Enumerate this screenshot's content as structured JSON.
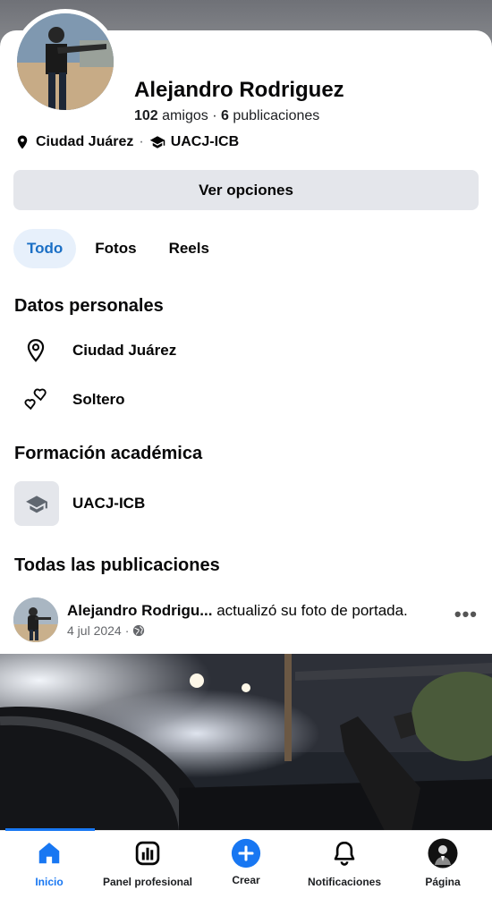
{
  "profile": {
    "name": "Alejandro Rodriguez",
    "friends_count": "102",
    "friends_label": "amigos",
    "separator": "·",
    "posts_count": "6",
    "posts_label": "publicaciones",
    "city": "Ciudad Juárez",
    "school": "UACJ-ICB"
  },
  "actions": {
    "options_label": "Ver opciones"
  },
  "tabs": [
    {
      "label": "Todo",
      "active": true
    },
    {
      "label": "Fotos",
      "active": false
    },
    {
      "label": "Reels",
      "active": false
    }
  ],
  "personal": {
    "title": "Datos personales",
    "location": "Ciudad Juárez",
    "relationship": "Soltero"
  },
  "education": {
    "title": "Formación académica",
    "school": "UACJ-ICB"
  },
  "posts": {
    "title": "Todas las publicaciones",
    "items": [
      {
        "author": "Alejandro Rodrigu...",
        "action": "actualizó su foto de portada.",
        "date": "4 jul 2024",
        "audience_icon": "globe-icon"
      }
    ]
  },
  "navbar": {
    "items": [
      {
        "label": "Inicio",
        "icon": "home-icon",
        "active": true
      },
      {
        "label": "Panel profesional",
        "icon": "dashboard-icon",
        "active": false
      },
      {
        "label": "Crear",
        "icon": "plus-icon",
        "active": false
      },
      {
        "label": "Notificaciones",
        "icon": "bell-icon",
        "active": false
      },
      {
        "label": "Página",
        "icon": "page-avatar-icon",
        "active": false
      }
    ]
  },
  "colors": {
    "accent": "#1877f2",
    "tab_active_bg": "#e7f0fb",
    "button_bg": "#e4e6eb"
  }
}
